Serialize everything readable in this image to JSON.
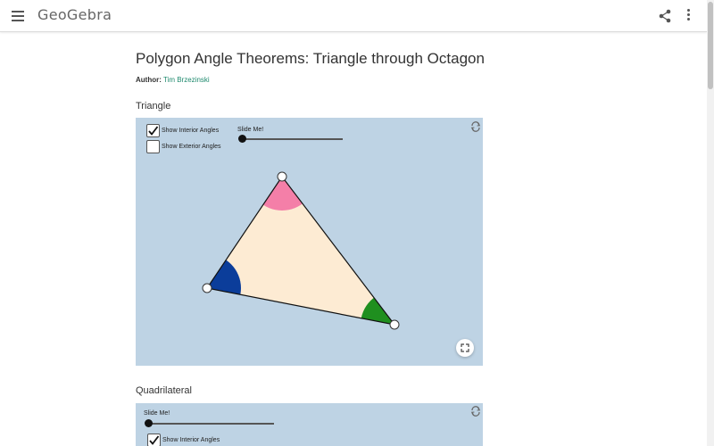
{
  "header": {
    "logo_text": "GeoGebra",
    "icons": [
      "menu-icon",
      "share-icon",
      "more-vert-icon"
    ]
  },
  "page": {
    "title": "Polygon Angle Theorems: Triangle through Octagon",
    "author_label": "Author:",
    "author_name": "Tim Brzezinski"
  },
  "sections": [
    {
      "title": "Triangle",
      "applet": {
        "background": "#bed3e4",
        "checkboxes": [
          {
            "label": "Show Interior Angles",
            "checked": true
          },
          {
            "label": "Show Exterior Angles",
            "checked": false
          }
        ],
        "slider": {
          "label": "Slide Me!",
          "value": 0
        },
        "polygon_fill": "#fdebd3",
        "angle_colors": {
          "top": "#f47fa8",
          "left": "#0b3d9a",
          "right": "#1f8f1f"
        },
        "icons": [
          "reset-icon",
          "fullscreen-icon"
        ]
      }
    },
    {
      "title": "Quadrilateral",
      "applet": {
        "background": "#bed3e4",
        "slider": {
          "label": "Slide Me!",
          "value": 0
        },
        "checkboxes": [
          {
            "label": "Show Interior Angles",
            "checked": true
          }
        ],
        "icons": [
          "reset-icon"
        ]
      }
    }
  ]
}
